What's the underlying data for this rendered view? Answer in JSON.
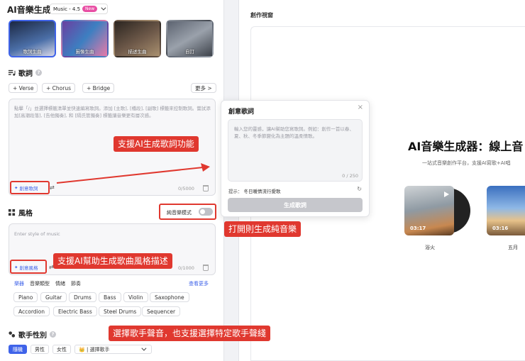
{
  "header": {
    "title": "AI音樂生成",
    "version": "Music - 4.5",
    "new_badge": "New"
  },
  "modes": [
    {
      "label": "歌詞生曲",
      "selected": true
    },
    {
      "label": "圖像生曲",
      "selected": false
    },
    {
      "label": "描述生曲",
      "selected": false
    },
    {
      "label": "自訂",
      "selected": false
    }
  ],
  "lyrics": {
    "section_title": "歌詞",
    "chips": [
      "+ Verse",
      "+ Chorus",
      "+ Bridge"
    ],
    "more": "更多 >",
    "placeholder": "點擊「/」並選擇標籤清單並快速編寫歌詞。添加 [主歌], [橋段], [副歌] 標籤來控制歌詞。嘗試添加[高潮段落], [告他獨奏], 和 [隔氏管獨奏] 標籤讓音樂更有層次感。",
    "creative_btn": "創意歌詞",
    "count": "0/5000"
  },
  "style": {
    "section_title": "風格",
    "instrumental_label": "純音樂模式",
    "placeholder": "Enter style of music",
    "creative_btn": "創意風格",
    "count": "0/1000",
    "tabs": [
      "樂器",
      "音樂類型",
      "情緒",
      "節奏"
    ],
    "see_more": "查看更多",
    "instruments_row1": [
      "Piano",
      "Guitar",
      "Drums",
      "Bass",
      "Violin",
      "Saxophone"
    ],
    "instruments_row2": [
      "Accordion",
      "Electric Bass",
      "Steel Drums",
      "Sequencer"
    ]
  },
  "singer": {
    "section_title": "歌手性別",
    "options": [
      "隨機",
      "男性",
      "女性"
    ],
    "select_label": "👑 | 選擇歌手"
  },
  "popup": {
    "title": "創意歌詞",
    "close": "×",
    "placeholder": "輸入您的靈感，讓AI幫助您寫歌詞。例如：創作一首以春、夏、秋、冬季節變化為主題的溫柔情歌。",
    "count": "0 / 250",
    "hint_label": "提示：",
    "hint_text": "冬日暖情流行愛歌",
    "button": "生成歌詞"
  },
  "annotations": {
    "lyrics": "支援AI生成歌詞功能",
    "instrumental": "打開則生成純音樂",
    "style": "支援AI幫助生成歌曲風格描述",
    "singer": "選擇歌手聲音，也支援選擇特定歌手聲綫"
  },
  "right": {
    "panel_title": "創作視窗",
    "hero": "AI音樂生成器：線上音",
    "subtitle": "一站式音樂創作平台，支援AI寫歌+AI唱",
    "songs": [
      {
        "name": "浴火",
        "duration": "03:17"
      },
      {
        "name": "五月",
        "duration": "03:16"
      }
    ]
  },
  "colors": {
    "accent": "#3f63e9",
    "annotation": "#e0382f",
    "new_badge": "#e84fa4"
  }
}
